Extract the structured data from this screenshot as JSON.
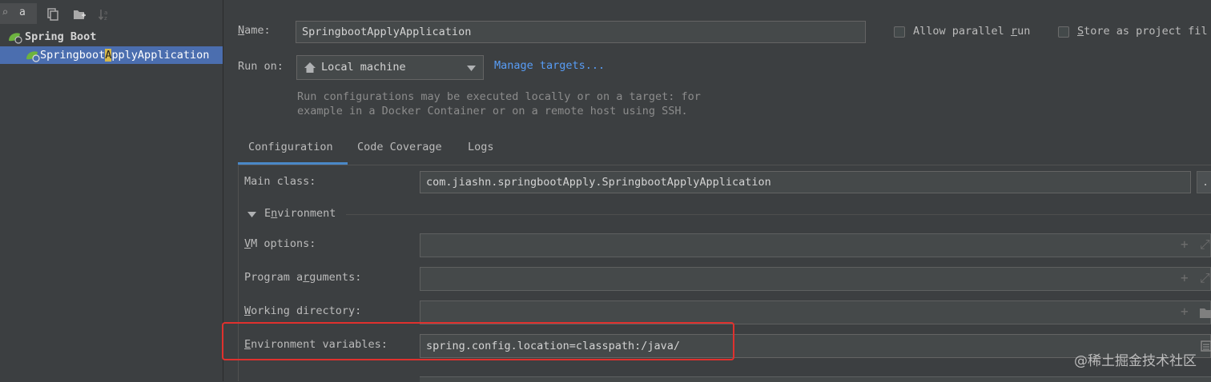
{
  "left": {
    "search_glyph": "⌕",
    "search_text": "a",
    "tree_parent": "Spring Boot",
    "tree_child_before": "Springboot",
    "tree_child_hl": "A",
    "tree_child_after": "pplyApplication"
  },
  "form": {
    "name_label": "ame:",
    "name_label_mnemonic": "N",
    "name_value": "SpringbootApplyApplication",
    "allow_parallel_before": "Allow parallel ",
    "allow_parallel_mn": "r",
    "allow_parallel_after": "un",
    "store_mn": "S",
    "store_after": "tore as project fil",
    "run_on_label": "Run on:",
    "run_on_value": "Local machine",
    "manage_targets": "Manage targets...",
    "help_line1": "Run configurations may be executed locally or on a target: for",
    "help_line2": "example in a Docker Container or on a remote host using SSH."
  },
  "tabs": [
    "Configuration",
    "Code Coverage",
    "Logs"
  ],
  "config": {
    "main_class_label": "Main class:",
    "main_class_value": "com.jiashn.springbootApply.SpringbootApplyApplication",
    "env_section": "Environment",
    "env_section_mn": "n",
    "vm_mn": "V",
    "vm_rest": "M options:",
    "prog_before": "Program a",
    "prog_mn": "r",
    "prog_after": "guments:",
    "wd_mn": "W",
    "wd_rest": "orking directory:",
    "envvar_mn": "E",
    "envvar_rest": "nvironment variables:",
    "envvar_value": "spring.config.location=classpath:/java/"
  },
  "watermark": "@稀土掘金技术社区",
  "colors": {
    "accent": "#4a88c7",
    "selection": "#4b6eaf",
    "highlight_box": "#e0312e"
  }
}
